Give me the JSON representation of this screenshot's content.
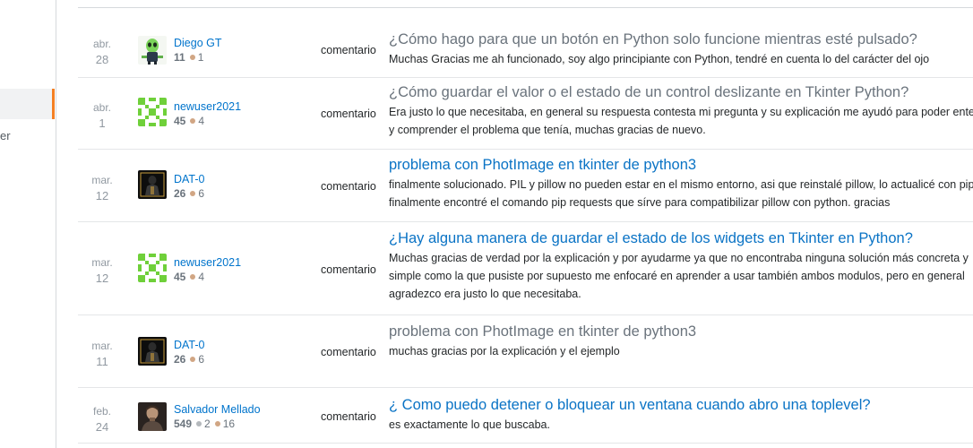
{
  "sidebar": {
    "fragment_label": "er"
  },
  "activity": [
    {
      "month": "abr.",
      "day": "28",
      "user": {
        "name": "Diego GT",
        "reputation": "11",
        "badges": [
          {
            "kind": "bronze",
            "count": "1"
          }
        ],
        "avatar": "alien-avatar"
      },
      "type": "comentario",
      "title": "¿Cómo hago para que un botón en Python solo funcione mientras esté pulsado?",
      "title_style": "visited",
      "comment": "Muchas Gracias me ah funcionado, soy algo principiante con Python, tendré en cuenta lo del carácter del ojo"
    },
    {
      "month": "abr.",
      "day": "1",
      "user": {
        "name": "newuser2021",
        "reputation": "45",
        "badges": [
          {
            "kind": "bronze",
            "count": "4"
          }
        ],
        "avatar": "identicon-avatar"
      },
      "type": "comentario",
      "title": "¿Cómo guardar el valor o el estado de un control deslizante en Tkinter Python?",
      "title_style": "visited",
      "comment": "Era justo lo que necesitaba, en general su respuesta contesta mi pregunta y su explicación me ayudó para poder entender y comprender el problema que tenía, muchas gracias de nuevo."
    },
    {
      "month": "mar.",
      "day": "12",
      "user": {
        "name": "DAT-0",
        "reputation": "26",
        "badges": [
          {
            "kind": "bronze",
            "count": "6"
          }
        ],
        "avatar": "dark-avatar"
      },
      "type": "comentario",
      "title": "problema con PhotImage en tkinter de python3",
      "title_style": "link",
      "comment": "finalmente solucionado. PIL y pillow no pueden estar en el mismo entorno, asi que reinstalé pillow, lo actualicé con pip y finalmente encontré el comando pip requests que sírve para compatibilizar pillow con python. gracias"
    },
    {
      "month": "mar.",
      "day": "12",
      "user": {
        "name": "newuser2021",
        "reputation": "45",
        "badges": [
          {
            "kind": "bronze",
            "count": "4"
          }
        ],
        "avatar": "identicon-avatar"
      },
      "type": "comentario",
      "title": "¿Hay alguna manera de guardar el estado de los widgets en Tkinter en Python?",
      "title_style": "link",
      "comment": "Muchas gracias de verdad por la explicación y por ayudarme ya que no encontraba ninguna solución más concreta y simple como la que pusiste por supuesto me enfocaré en aprender a usar también ambos modulos, pero en general agradezco era justo lo que necesitaba."
    },
    {
      "month": "mar.",
      "day": "11",
      "user": {
        "name": "DAT-0",
        "reputation": "26",
        "badges": [
          {
            "kind": "bronze",
            "count": "6"
          }
        ],
        "avatar": "dark-avatar"
      },
      "type": "comentario",
      "title": "problema con PhotImage en tkinter de python3",
      "title_style": "visited",
      "comment": "muchas gracias por la explicación y el ejemplo"
    },
    {
      "month": "feb.",
      "day": "24",
      "user": {
        "name": "Salvador Mellado",
        "reputation": "549",
        "badges": [
          {
            "kind": "silver",
            "count": "2"
          },
          {
            "kind": "bronze",
            "count": "16"
          }
        ],
        "avatar": "photo-avatar"
      },
      "type": "comentario",
      "title": "¿ Como puedo detener o bloquear un ventana cuando abro una toplevel?",
      "title_style": "link",
      "comment": "es exactamente lo que buscaba."
    }
  ]
}
